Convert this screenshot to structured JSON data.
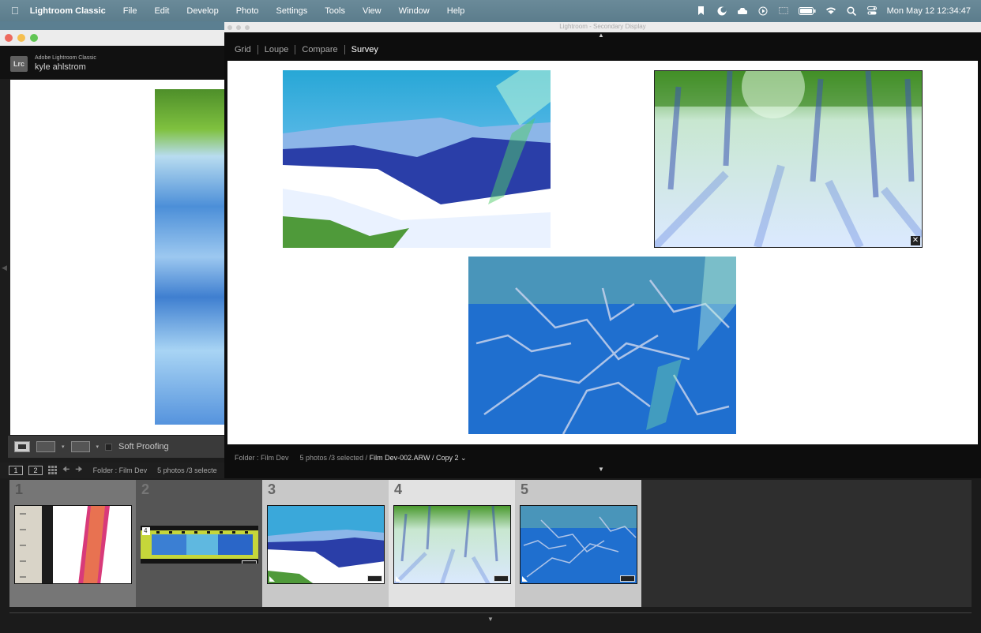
{
  "menubar": {
    "app_name": "Lightroom Classic",
    "items": [
      "File",
      "Edit",
      "Develop",
      "Photo",
      "Settings",
      "Tools",
      "View",
      "Window",
      "Help"
    ],
    "clock": "Mon May 12  12:34:47"
  },
  "main_window": {
    "brand": "Adobe Lightroom Classic",
    "logo_text": "Lrc",
    "user_name": "kyle ahlstrom",
    "soft_proofing_label": "Soft Proofing",
    "screen_buttons": [
      "1",
      "2"
    ],
    "source_label": "Folder : Film Dev",
    "count_label": "5 photos /3 selecte"
  },
  "secondary_window": {
    "title": "Lightroom - Secondary Display",
    "view_modes": [
      "Grid",
      "Loupe",
      "Compare",
      "Survey"
    ],
    "active_view": "Survey",
    "status_folder": "Folder : Film Dev",
    "status_count": "5 photos /3 selected /",
    "status_file": "Film Dev-002.ARW / Copy 2 ⌄"
  },
  "filmstrip": {
    "cells": [
      {
        "number": "1",
        "selected": false
      },
      {
        "number": "2",
        "selected": false
      },
      {
        "number": "3",
        "selected": true
      },
      {
        "number": "4",
        "selected": true
      },
      {
        "number": "5",
        "selected": true
      }
    ],
    "film_strip_frame_label": "4"
  },
  "colors": {
    "selected_cell": "#c8c8c8",
    "active_cell": "#e2e2e2",
    "dim_cell": "#767676",
    "cell_bg": "#555555",
    "accent_light": "#ffffff"
  }
}
